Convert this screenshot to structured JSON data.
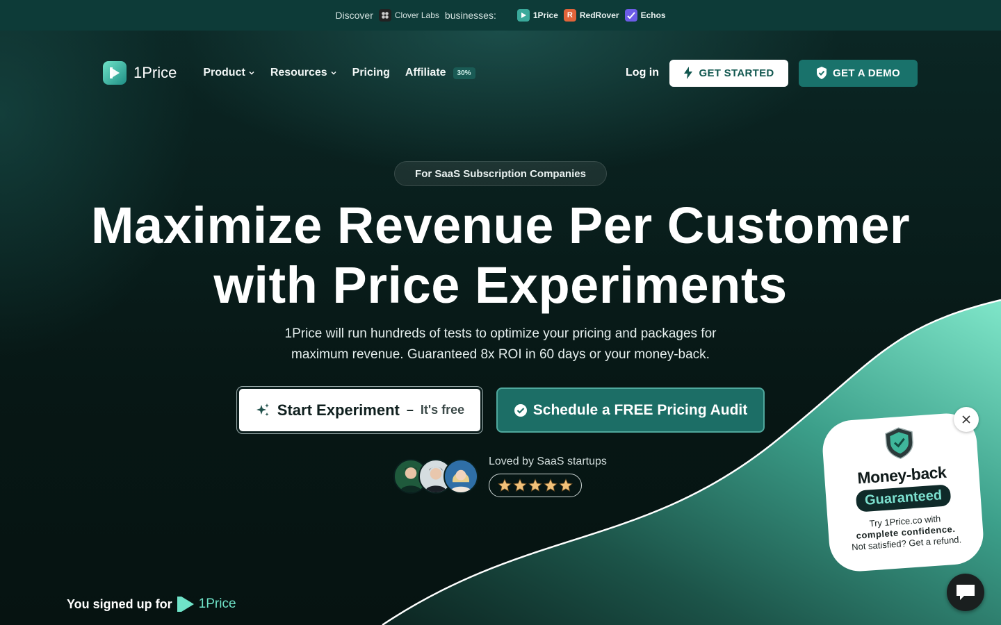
{
  "topbar": {
    "discover": "Discover",
    "clover_labs": "Clover Labs",
    "businesses": "businesses:",
    "brands": [
      {
        "name": "1Price",
        "color": "#3aa99b"
      },
      {
        "name": "RedRover",
        "color": "#e2643a"
      },
      {
        "name": "Echos",
        "color": "#6c5ce7"
      }
    ]
  },
  "nav": {
    "logo": "1Price",
    "product": "Product",
    "resources": "Resources",
    "pricing": "Pricing",
    "affiliate": "Affiliate",
    "affiliate_badge": "30%",
    "login": "Log in",
    "get_started": "GET STARTED",
    "get_demo": "GET A DEMO"
  },
  "hero": {
    "pill": "For SaaS Subscription Companies",
    "headline_line1": "Maximize Revenue Per Customer",
    "headline_line2": "with Price Experiments",
    "sub_line1": "1Price will run hundreds of tests to optimize your pricing and packages for",
    "sub_line2": "maximum revenue. Guaranteed 8x ROI in 60 days or your money-back.",
    "cta_primary": "Start Experiment",
    "cta_primary_dash": "–",
    "cta_primary_free": "It's free",
    "cta_secondary": "Schedule a FREE Pricing Audit",
    "loved": "Loved by SaaS startups",
    "rating": 5
  },
  "money_back": {
    "title": "Money-back",
    "guaranteed": "Guaranteed",
    "line1": "Try 1Price.co with",
    "line2": "complete confidence.",
    "line3": "Not satisfied? Get a refund."
  },
  "toast": {
    "text": "You signed up for",
    "brand": "1Price"
  },
  "colors": {
    "accent": "#19726b",
    "mint": "#6fe3c8",
    "bg": "#071a19"
  }
}
